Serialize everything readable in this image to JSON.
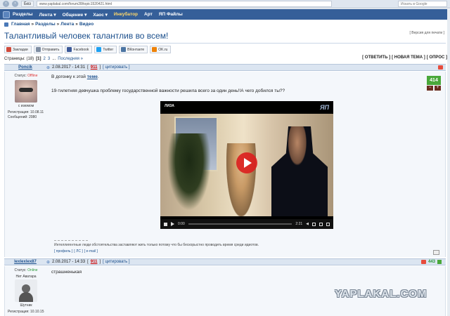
{
  "browser": {
    "tab_label": "Без",
    "url": "www.yaplakal.com/forum28/topic1520421.html",
    "search_placeholder": "Искать в Google"
  },
  "topnav": {
    "items": [
      "Разделы",
      "Лента ▾",
      "Общение ▾",
      "Хаос ▾",
      "Инкубатор",
      "Арт",
      "ЯП Файлы"
    ]
  },
  "breadcrumb": [
    "Главная",
    "Разделы",
    "Лента",
    "Видео"
  ],
  "topic": {
    "title": "Талантливый человек талантлив во всем!",
    "print_version": "[ Версия для печати ]"
  },
  "share": {
    "buttons": [
      {
        "label": "Закладки",
        "icon": "bookmark-icon",
        "color": "#d04a3a"
      },
      {
        "label": "Отправить",
        "icon": "mail-icon",
        "color": "#7f8ea3"
      },
      {
        "label": "Facebook",
        "icon": "facebook-icon",
        "color": "#3b5998"
      },
      {
        "label": "Twitter",
        "icon": "twitter-icon",
        "color": "#1da1f2"
      },
      {
        "label": "ВКонтакте",
        "icon": "vk-icon",
        "color": "#4c75a3"
      },
      {
        "label": "OK.ru",
        "icon": "ok-icon",
        "color": "#ee8208"
      }
    ]
  },
  "pager": {
    "label": "Страницы: (18)",
    "current": "[1]",
    "pages": [
      "2",
      "3"
    ],
    "ellipsis": "...",
    "last": "Последняя »",
    "actions": [
      "[ ОТВЕТИТЬ ]",
      "[ НОВАЯ ТЕМА ]",
      "[ ОПРОС ]"
    ]
  },
  "posts": [
    {
      "author": "Poncik",
      "status_label": "Статус:",
      "status": "Offline",
      "avatar_caption": "с изюмом",
      "reg_label": "Регистрация: 10.08.11",
      "posts_label": "Сообщений: 2080",
      "date": "2.08.2017 - 14:31",
      "number": "911",
      "quote": "[ цитировать ]",
      "text_before_link": "В догонку к этой ",
      "link": "теме",
      "text_after_link": ".",
      "text2": "19-тилетняя девчушка проблему государственной важности решила всего за один день!!А чего добился ты??",
      "rating": "414",
      "video": {
        "title": "ЛИЗА",
        "watermark": "ЯП",
        "time_current": "0:00",
        "time_total": "2:21"
      },
      "signature": "Интеллигентные люди обстоятельства заставляют жить только потому что бы бескорыстно проводить время среди идиотов.",
      "footer": [
        "[ профиль ]",
        "[ ЛС ]",
        "[ e-mail ]"
      ]
    },
    {
      "author": "lexlexlex87",
      "status_label": "Статус:",
      "status": "Online",
      "avatar_caption": "Нет Аватара",
      "avatar_name": "Шутник",
      "reg_label": "Регистрация: 10.10.15",
      "date": "2.08.2017 - 14:33",
      "number": "911",
      "quote": "[ цитировать ]",
      "text": "страшненькая",
      "rating": "443"
    }
  ],
  "watermark": "YAPLAKAL.COM",
  "colors": {
    "nav_bg": "#355f99",
    "link": "#1b4f8c",
    "rating_bg": "#4aa83a",
    "post_header_bg": "#dbe5f1"
  }
}
